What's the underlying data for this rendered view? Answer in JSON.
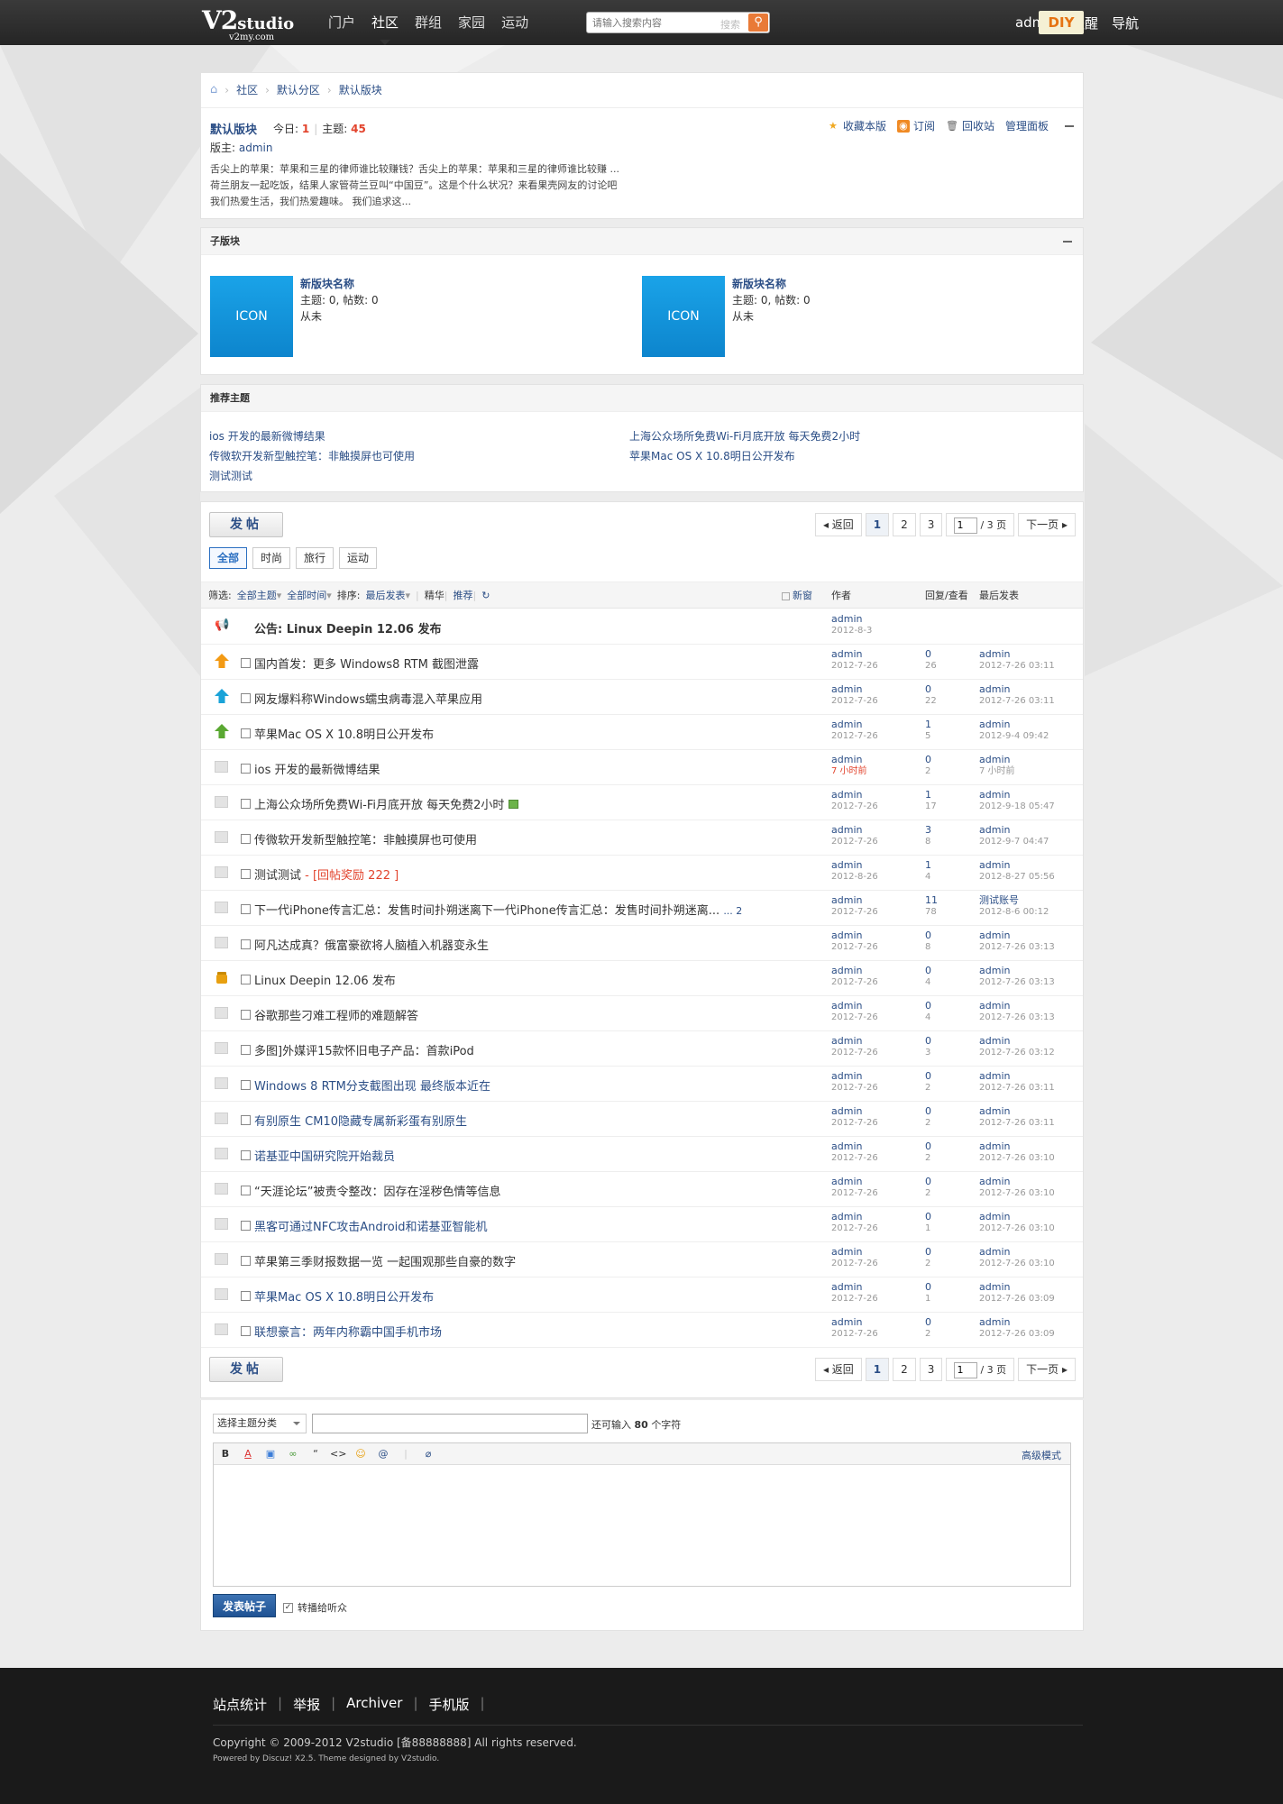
{
  "header": {
    "logo_main": "V2",
    "logo_tail": "studio",
    "logo_sub": "v2my.com",
    "nav": [
      "门户",
      "社区",
      "群组",
      "家园",
      "运动"
    ],
    "active_nav": "社区",
    "search_placeholder": "请输入搜索内容",
    "search_type": "搜索",
    "user": "admin",
    "links": [
      "提醒",
      "导航"
    ],
    "diy": "DIY"
  },
  "breadcrumb": [
    "社区",
    "默认分区",
    "默认版块"
  ],
  "forum": {
    "name": "默认版块",
    "today_label": "今日:",
    "today": "1",
    "threads_label": "主题:",
    "threads": "45",
    "moderator_label": "版主:",
    "moderator": "admin",
    "rules": [
      "舌尖上的苹果：苹果和三星的律师谁比较赚钱？舌尖上的苹果：苹果和三星的律师谁比较赚 ...",
      "荷兰朋友一起吃饭，结果人家管荷兰豆叫“中国豆”。这是个什么状况？来看果壳网友的讨论吧",
      "我们热爱生活，我们热爱趣味。 我们追求这..."
    ],
    "actions": [
      "收藏本版",
      "订阅",
      "回收站",
      "管理面板"
    ]
  },
  "subforums": {
    "title": "子版块",
    "items": [
      {
        "icon": "ICON",
        "name": "新版块名称",
        "stats": "主题: 0, 帖数: 0",
        "last": "从未"
      },
      {
        "icon": "ICON",
        "name": "新版块名称",
        "stats": "主题: 0, 帖数: 0",
        "last": "从未"
      }
    ]
  },
  "recommended": {
    "title": "推荐主题",
    "items": [
      "ios 开发的最新微博结果",
      "上海公众场所免费Wi-Fi月底开放 每天免费2小时",
      "传微软开发新型触控笔：非触摸屏也可使用",
      "苹果Mac OS X 10.8明日公开发布",
      "测试测试"
    ]
  },
  "threadlist": {
    "post_button": "发帖",
    "pager": {
      "back": "返回",
      "pages": [
        "1",
        "2",
        "3"
      ],
      "current": "1",
      "input": "1",
      "total": "/ 3 页",
      "next": "下一页"
    },
    "type_tabs": [
      "全部",
      "时尚",
      "旅行",
      "运动"
    ],
    "active_tab": "全部",
    "filter": {
      "label": "筛选:",
      "all_threads": "全部主题",
      "all_time": "全部时间",
      "sort_label": "排序:",
      "sort": "最后发表",
      "digest": "精华",
      "recommend": "推荐",
      "new_window": "新窗",
      "col_author": "作者",
      "col_replies": "回复/查看",
      "col_last": "最后发表"
    },
    "threads": [
      {
        "icon": "announce-icon",
        "title": "公告: Linux Deepin 12.06 发布",
        "author": "admin",
        "date": "2012-8-3",
        "replies": "",
        "views": "",
        "last_user": "",
        "last_time": ""
      },
      {
        "icon": "pin-top-icon",
        "title": "国内首发：更多 Windows8 RTM 截图泄露",
        "author": "admin",
        "date": "2012-7-26",
        "replies": "0",
        "views": "26",
        "last_user": "admin",
        "last_time": "2012-7-26 03:11"
      },
      {
        "icon": "pin-category-icon",
        "title": "网友爆料称Windows蠕虫病毒混入苹果应用",
        "author": "admin",
        "date": "2012-7-26",
        "replies": "0",
        "views": "22",
        "last_user": "admin",
        "last_time": "2012-7-26 03:11"
      },
      {
        "icon": "pin-section-icon",
        "title": "苹果Mac OS X 10.8明日公开发布",
        "author": "admin",
        "date": "2012-7-26",
        "replies": "1",
        "views": "5",
        "last_user": "admin",
        "last_time": "2012-9-4 09:42"
      },
      {
        "icon": "folder-icon",
        "title": "ios 开发的最新微博结果",
        "author": "admin",
        "date": "7 小时前",
        "replies": "0",
        "views": "2",
        "last_user": "admin",
        "last_time": "7 小时前"
      },
      {
        "icon": "folder-icon",
        "title": "上海公众场所免费Wi-Fi月底开放 每天免费2小时",
        "author": "admin",
        "date": "2012-7-26",
        "replies": "1",
        "views": "17",
        "last_user": "admin",
        "last_time": "2012-9-18 05:47"
      },
      {
        "icon": "folder-icon",
        "title": "传微软开发新型触控笔：非触摸屏也可使用",
        "author": "admin",
        "date": "2012-7-26",
        "replies": "3",
        "views": "8",
        "last_user": "admin",
        "last_time": "2012-9-7 04:47"
      },
      {
        "icon": "folder-icon",
        "title": "测试测试",
        "reward": "- [回帖奖励 222 ]",
        "author": "admin",
        "date": "2012-8-26",
        "replies": "1",
        "views": "4",
        "last_user": "admin",
        "last_time": "2012-8-27 05:56"
      },
      {
        "icon": "folder-icon",
        "title": "下一代iPhone传言汇总：发售时间扑朔迷离下一代iPhone传言汇总：发售时间扑朔迷离...",
        "pages_hint": "... 2",
        "author": "admin",
        "date": "2012-7-26",
        "replies": "11",
        "views": "78",
        "last_user": "测试账号",
        "last_time": "2012-8-6 00:12"
      },
      {
        "icon": "folder-icon",
        "title": "阿凡达成真？俄富豪欲将人脑植入机器变永生",
        "author": "admin",
        "date": "2012-7-26",
        "replies": "0",
        "views": "8",
        "last_user": "admin",
        "last_time": "2012-7-26 03:13"
      },
      {
        "icon": "lock-icon",
        "title": "Linux Deepin 12.06 发布",
        "author": "admin",
        "date": "2012-7-26",
        "replies": "0",
        "views": "4",
        "last_user": "admin",
        "last_time": "2012-7-26 03:13"
      },
      {
        "icon": "folder-icon",
        "title": "谷歌那些刁难工程师的难题解答",
        "author": "admin",
        "date": "2012-7-26",
        "replies": "0",
        "views": "4",
        "last_user": "admin",
        "last_time": "2012-7-26 03:13"
      },
      {
        "icon": "folder-icon",
        "title": "多图]外媒评15款怀旧电子产品：首款iPod",
        "author": "admin",
        "date": "2012-7-26",
        "replies": "0",
        "views": "3",
        "last_user": "admin",
        "last_time": "2012-7-26 03:12"
      },
      {
        "icon": "folder-icon",
        "title": "Windows 8 RTM分支截图出现 最终版本近在",
        "blue": true,
        "author": "admin",
        "date": "2012-7-26",
        "replies": "0",
        "views": "2",
        "last_user": "admin",
        "last_time": "2012-7-26 03:11"
      },
      {
        "icon": "folder-icon",
        "title": "有别原生 CM10隐藏专属新彩蛋有别原生",
        "blue": true,
        "author": "admin",
        "date": "2012-7-26",
        "replies": "0",
        "views": "2",
        "last_user": "admin",
        "last_time": "2012-7-26 03:11"
      },
      {
        "icon": "folder-icon",
        "title": "诺基亚中国研究院开始裁员",
        "blue": true,
        "author": "admin",
        "date": "2012-7-26",
        "replies": "0",
        "views": "2",
        "last_user": "admin",
        "last_time": "2012-7-26 03:10"
      },
      {
        "icon": "folder-icon",
        "title": "“天涯论坛”被责令整改：因存在淫秽色情等信息",
        "author": "admin",
        "date": "2012-7-26",
        "replies": "0",
        "views": "2",
        "last_user": "admin",
        "last_time": "2012-7-26 03:10"
      },
      {
        "icon": "folder-icon",
        "title": "黑客可通过NFC攻击Android和诺基亚智能机",
        "blue": true,
        "author": "admin",
        "date": "2012-7-26",
        "replies": "0",
        "views": "1",
        "last_user": "admin",
        "last_time": "2012-7-26 03:10"
      },
      {
        "icon": "folder-icon",
        "title": "苹果第三季财报数据一览 一起围观那些自豪的数字",
        "author": "admin",
        "date": "2012-7-26",
        "replies": "0",
        "views": "2",
        "last_user": "admin",
        "last_time": "2012-7-26 03:10"
      },
      {
        "icon": "folder-icon",
        "title": "苹果Mac OS X 10.8明日公开发布",
        "blue": true,
        "author": "admin",
        "date": "2012-7-26",
        "replies": "0",
        "views": "1",
        "last_user": "admin",
        "last_time": "2012-7-26 03:09"
      },
      {
        "icon": "folder-icon",
        "title": "联想豪言：两年内称霸中国手机市场",
        "blue": true,
        "author": "admin",
        "date": "2012-7-26",
        "replies": "0",
        "views": "2",
        "last_user": "admin",
        "last_time": "2012-7-26 03:09"
      }
    ]
  },
  "quickpost": {
    "type_select": "选择主题分类",
    "char_hint_pre": "还可输入",
    "char_count": "80",
    "char_hint_post": "个字符",
    "advanced": "高级模式",
    "submit": "发表帖子",
    "share": "转播给听众"
  },
  "footer": {
    "links": [
      "站点统计",
      "举报",
      "Archiver",
      "手机版"
    ],
    "copyright": "Copyright © 2009-2012 V2studio [备88888888] All rights reserved.",
    "powered": "Powered by Discuz! X2.5. Theme designed by V2studio."
  }
}
